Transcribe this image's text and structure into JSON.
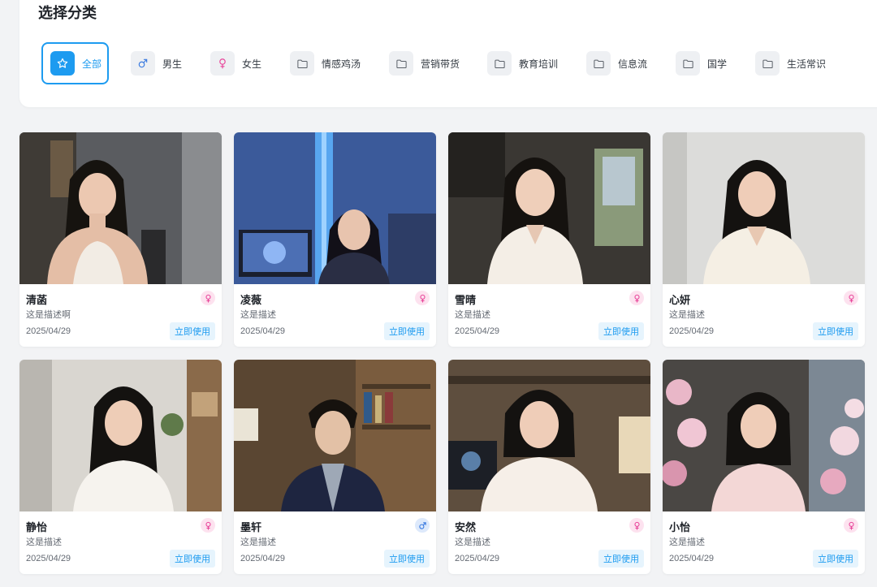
{
  "header": {
    "title": "选择分类"
  },
  "categories": [
    {
      "label": "全部",
      "icon": "star-icon",
      "active": true
    },
    {
      "label": "男生",
      "icon": "male-icon",
      "active": false
    },
    {
      "label": "女生",
      "icon": "female-icon",
      "active": false
    },
    {
      "label": "情感鸡汤",
      "icon": "folder-icon",
      "active": false
    },
    {
      "label": "营销带货",
      "icon": "folder-icon",
      "active": false
    },
    {
      "label": "教育培训",
      "icon": "folder-icon",
      "active": false
    },
    {
      "label": "信息流",
      "icon": "folder-icon",
      "active": false
    },
    {
      "label": "国学",
      "icon": "folder-icon",
      "active": false
    },
    {
      "label": "生活常识",
      "icon": "folder-icon",
      "active": false
    }
  ],
  "avatars": [
    {
      "name": "清菡",
      "desc": "这是描述啊",
      "date": "2025/04/29",
      "gender": "female",
      "action": "立即使用"
    },
    {
      "name": "凌薇",
      "desc": "这是描述",
      "date": "2025/04/29",
      "gender": "female",
      "action": "立即使用"
    },
    {
      "name": "雪晴",
      "desc": "这是描述",
      "date": "2025/04/29",
      "gender": "female",
      "action": "立即使用"
    },
    {
      "name": "心妍",
      "desc": "这是描述",
      "date": "2025/04/29",
      "gender": "female",
      "action": "立即使用"
    },
    {
      "name": "静怡",
      "desc": "这是描述",
      "date": "2025/04/29",
      "gender": "female",
      "action": "立即使用"
    },
    {
      "name": "墨轩",
      "desc": "这是描述",
      "date": "2025/04/29",
      "gender": "male",
      "action": "立即使用"
    },
    {
      "name": "安然",
      "desc": "这是描述",
      "date": "2025/04/29",
      "gender": "female",
      "action": "立即使用"
    },
    {
      "name": "小怡",
      "desc": "这是描述",
      "date": "2025/04/29",
      "gender": "female",
      "action": "立即使用"
    }
  ],
  "colors": {
    "accent": "#1d9bf0",
    "female": "#e8459a",
    "male": "#3b7be0"
  }
}
